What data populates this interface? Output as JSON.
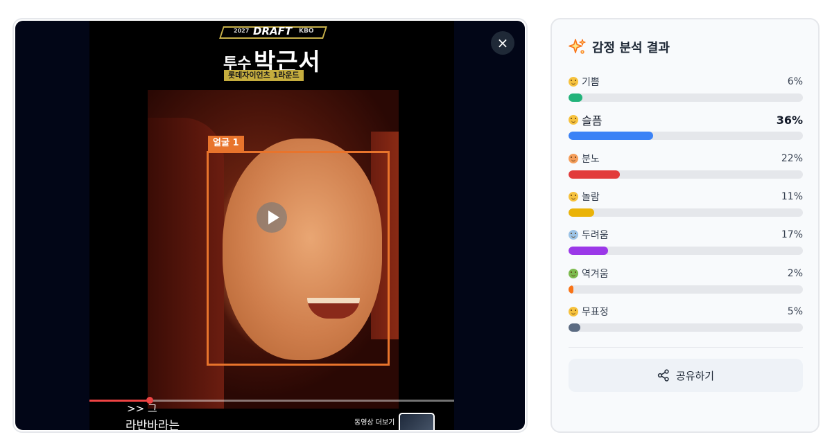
{
  "video": {
    "banner": {
      "year": "2027",
      "event": "DRAFT",
      "league": "KBO",
      "position": "투수",
      "player_name": "박근서",
      "team_round": "롯데자이언츠 1라운드"
    },
    "face_label": "얼굴 1",
    "progress": 0.165,
    "subtitle_line1": ">> 그",
    "subtitle_line2": "라반바라는",
    "more_videos_label": "동영상 더보기",
    "close_icon": "×"
  },
  "panel": {
    "icon": "sparkle-icon",
    "title": "감정 분석 결과",
    "emotions": [
      {
        "label": "기쁨",
        "percent_text": "6%",
        "value": 6,
        "color": "#22b37a",
        "emoji_color": "#f6c23e"
      },
      {
        "label": "슬픔",
        "percent_text": "36%",
        "value": 36,
        "color": "#3b82f6",
        "emoji_color": "#f6c23e"
      },
      {
        "label": "분노",
        "percent_text": "22%",
        "value": 22,
        "color": "#e23b3b",
        "emoji_color": "#f59e5b"
      },
      {
        "label": "놀람",
        "percent_text": "11%",
        "value": 11,
        "color": "#eab308",
        "emoji_color": "#f6c23e"
      },
      {
        "label": "두려움",
        "percent_text": "17%",
        "value": 17,
        "color": "#9b38e8",
        "emoji_color": "#9cc3e6"
      },
      {
        "label": "역겨움",
        "percent_text": "2%",
        "value": 2,
        "color": "#f97316",
        "emoji_color": "#7dbb4f"
      },
      {
        "label": "무표정",
        "percent_text": "5%",
        "value": 5,
        "color": "#5b6b82",
        "emoji_color": "#f6c23e"
      }
    ],
    "highlight_index": 1,
    "share_label": "공유하기"
  }
}
